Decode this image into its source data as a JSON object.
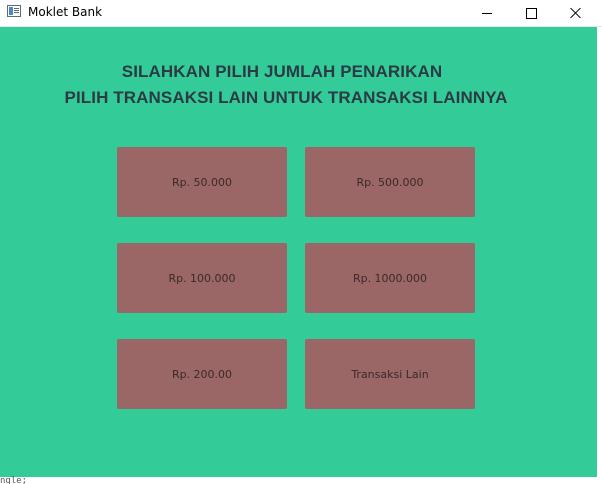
{
  "window": {
    "title": "Moklet Bank",
    "minimize_label": "",
    "maximize_label": "",
    "close_label": ""
  },
  "heading": {
    "line1": "SILAHKAN PILIH JUMLAH PENARIKAN",
    "line2": "PILIH TRANSAKSI LAIN UNTUK TRANSAKSI LAINNYA"
  },
  "buttons": [
    {
      "label": "Rp. 50.000"
    },
    {
      "label": "Rp. 500.000"
    },
    {
      "label": "Rp. 100.000"
    },
    {
      "label": "Rp. 1000.000"
    },
    {
      "label": "Rp. 200.00"
    },
    {
      "label": "Transaksi Lain"
    }
  ],
  "background_fragment": "ngle;",
  "colors": {
    "panel_background": "#33cc99",
    "button_background": "#9a6766",
    "heading_text": "#2b3a44"
  },
  "icons": {
    "app": "java-window-icon",
    "minimize": "minimize-icon",
    "maximize": "maximize-icon",
    "close": "close-icon"
  }
}
